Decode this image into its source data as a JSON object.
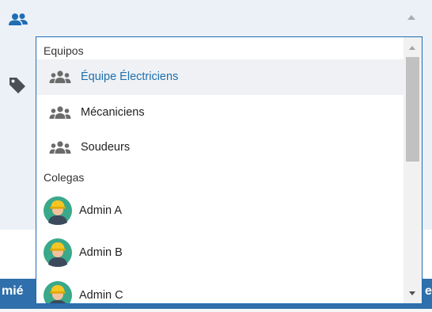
{
  "colors": {
    "accent": "#1f6db3",
    "selected_text": "#1d6fae",
    "panel_background": "#ecf1f7",
    "bottom_bar": "#2f6fab",
    "group_icon": "#6b6b6b"
  },
  "field": {
    "icon": "people-icon",
    "toggle_icon": "caret-up-icon"
  },
  "side_icons": [
    "tag-icon"
  ],
  "dropdown": {
    "groups": [
      {
        "header": "Equipos",
        "options": [
          {
            "label": "Équipe Électriciens",
            "icon": "group-icon",
            "selected": true
          },
          {
            "label": "Mécaniciens",
            "icon": "group-icon",
            "selected": false
          },
          {
            "label": "Soudeurs",
            "icon": "group-icon",
            "selected": false
          }
        ]
      },
      {
        "header": "Colegas",
        "options": [
          {
            "label": "Admin A",
            "icon": "worker-avatar"
          },
          {
            "label": "Admin B",
            "icon": "worker-avatar"
          },
          {
            "label": "Admin C",
            "icon": "worker-avatar"
          }
        ]
      }
    ],
    "scrollbar": {
      "up_icon": "scroll-up-arrow",
      "down_icon": "scroll-down-arrow"
    }
  },
  "bottom": {
    "left_text": "mié",
    "right_text": "e"
  }
}
